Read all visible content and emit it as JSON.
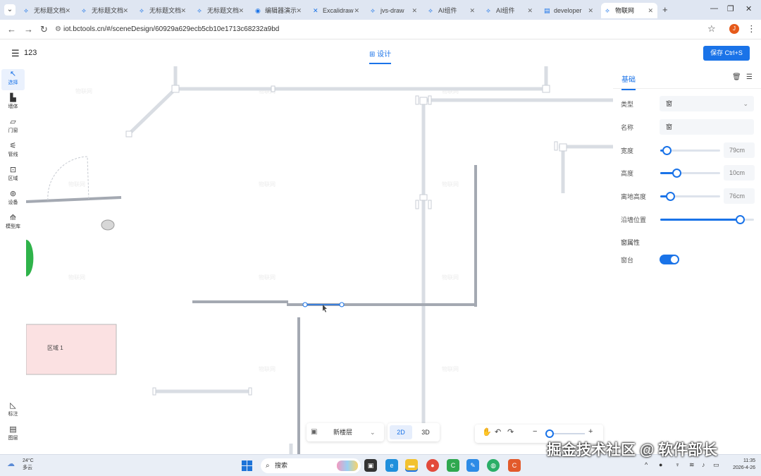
{
  "browser": {
    "tabs": [
      {
        "title": "无标题文档",
        "icon": "app-icon"
      },
      {
        "title": "无标题文档",
        "icon": "app-icon"
      },
      {
        "title": "无标题文档",
        "icon": "app-icon"
      },
      {
        "title": "无标题文档",
        "icon": "app-icon"
      },
      {
        "title": "编辑器演示",
        "icon": "globe-icon"
      },
      {
        "title": "Excalidraw",
        "icon": "excalidraw-icon"
      },
      {
        "title": "jvs-draw",
        "icon": "app-icon"
      },
      {
        "title": "AI组件",
        "icon": "app-icon"
      },
      {
        "title": "AI组件",
        "icon": "app-icon"
      },
      {
        "title": "developer",
        "icon": "doc-icon"
      },
      {
        "title": "物联网",
        "icon": "app-icon",
        "active": true
      }
    ],
    "url": "iot.bctools.cn/#/sceneDesign/60929a629ecb5cb10e1713c68232a9bd",
    "avatar_letter": "J"
  },
  "header": {
    "project_name": "123",
    "design_tab": "设计",
    "save_button": "保存 Ctrl+S"
  },
  "left_tools": [
    {
      "label": "选择",
      "icon": "cursor-icon",
      "active": true
    },
    {
      "label": "墙体",
      "icon": "wall-icon"
    },
    {
      "label": "门窗",
      "icon": "door-icon"
    },
    {
      "label": "管线",
      "icon": "pipe-icon"
    },
    {
      "label": "区域",
      "icon": "area-icon"
    },
    {
      "label": "设备",
      "icon": "device-icon"
    },
    {
      "label": "模型库",
      "icon": "model-icon"
    }
  ],
  "left_tools_bottom": [
    {
      "label": "标注",
      "icon": "measure-icon"
    },
    {
      "label": "图层",
      "icon": "layers-icon"
    }
  ],
  "canvas": {
    "area_label": "区域 1",
    "watermark": "物联网"
  },
  "bottom_controls": {
    "layer_name": "新楼层",
    "view_2d": "2D",
    "view_3d": "3D",
    "zoom_level": 0.1
  },
  "properties": {
    "tab_basic": "基础",
    "fields": {
      "type_label": "类型",
      "type_value": "窗",
      "name_label": "名称",
      "name_value": "窗",
      "width_label": "宽度",
      "width_value": "79cm",
      "width_level": 0.1,
      "height_label": "高度",
      "height_value": "10cm",
      "height_level": 0.27,
      "elev_label": "离地高度",
      "elev_value": "76cm",
      "elev_level": 0.16,
      "pos_label": "沿墙位置",
      "pos_level": 0.85
    },
    "window_props_title": "窗属性",
    "sill_label": "窗台",
    "sill_on": true
  },
  "taskbar": {
    "weather_temp": "24°C",
    "weather_desc": "多云",
    "weather_badge": "1",
    "search_placeholder": "搜索",
    "time": "11:35",
    "date": "2026-4-26"
  },
  "overlay_watermark": "掘金技术社区 @ 软件部长"
}
